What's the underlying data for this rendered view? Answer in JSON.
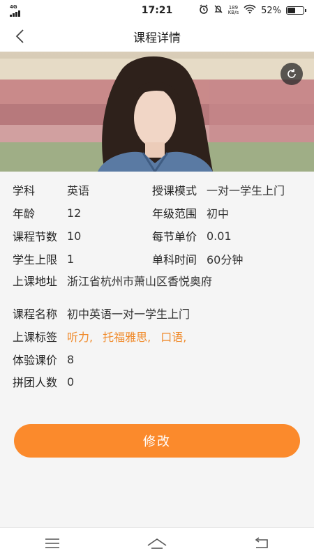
{
  "status": {
    "network": "4G",
    "time": "17:21",
    "speed_value": "189",
    "speed_unit": "KB/s",
    "battery": "52%",
    "battery_level": 0.52
  },
  "header": {
    "title": "课程详情"
  },
  "details": {
    "subject_label": "学科",
    "subject_value": "英语",
    "mode_label": "授课模式",
    "mode_value": "一对一学生上门",
    "age_label": "年龄",
    "age_value": "12",
    "grade_label": "年级范围",
    "grade_value": "初中",
    "lessons_label": "课程节数",
    "lessons_value": "10",
    "unit_price_label": "每节单价",
    "unit_price_value": "0.01",
    "limit_label": "学生上限",
    "limit_value": "1",
    "duration_label": "单科时间",
    "duration_value": "60分钟",
    "address_label": "上课地址",
    "address_value": "浙江省杭州市萧山区香悦奥府",
    "course_name_label": "课程名称",
    "course_name_value": "初中英语一对一学生上门",
    "tags_label": "上课标签",
    "tags": [
      "听力,",
      "托福雅思,",
      "口语,"
    ],
    "trial_price_label": "体验课价",
    "trial_price_value": "8",
    "group_label": "拼团人数",
    "group_value": "0"
  },
  "actions": {
    "submit_label": "修改"
  },
  "colors": {
    "accent": "#fb8a2c",
    "tag": "#f08a2a"
  }
}
